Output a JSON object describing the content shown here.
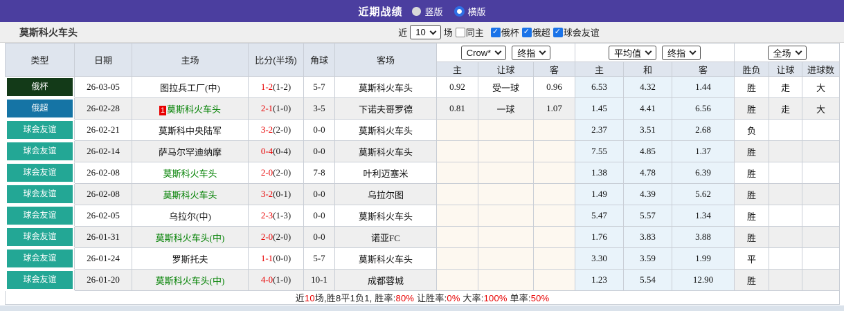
{
  "topbar": {
    "title": "近期战绩",
    "radio_vertical": "竖版",
    "radio_horizontal": "横版"
  },
  "toolbar": {
    "team": "莫斯科火车头",
    "near": "近",
    "count": "10",
    "games": "场",
    "same_home": "同主",
    "checks": [
      "俄杯",
      "俄超",
      "球会友谊"
    ]
  },
  "selects": {
    "bookmaker": "Crow*",
    "final_a": "终指",
    "avg": "平均值",
    "final_b": "终指",
    "scope": "全场"
  },
  "columns": {
    "type": "类型",
    "date": "日期",
    "home": "主场",
    "score": "比分(半场)",
    "corner": "角球",
    "away": "客场",
    "asia_home": "主",
    "asia_line": "让球",
    "asia_away": "客",
    "euro_home": "主",
    "euro_draw": "和",
    "euro_away": "客",
    "result": "胜负",
    "cover": "让球",
    "goals": "进球数"
  },
  "icons": {
    "checkbox-checked": "✓",
    "dropdown-chevron": "v"
  },
  "colors": {
    "topbar": "#4b3e9f",
    "cup": "#133a18",
    "super": "#1574a5",
    "friendly": "#23a795",
    "euro_bg": "#e9f3fa",
    "nodata_bg": "#fdf8f0",
    "win": "#e80000",
    "draw": "#008000",
    "lose": "#2626d9",
    "team_green": "#008000"
  },
  "table": {
    "rows": [
      {
        "cls": "cup",
        "type": "俄杯",
        "date": "26-03-05",
        "badge": "",
        "home": "图拉兵工厂(中)",
        "hg": false,
        "score": "1-2",
        "half": "(1-2)",
        "corner": "5-7",
        "away": "莫斯科火车头",
        "ag": true,
        "ah": "0.92",
        "line": "受一球",
        "aa": "0.96",
        "eh": "6.53",
        "ed": "4.32",
        "ea": "1.44",
        "res": "胜",
        "resc": "r",
        "cov": "走",
        "covc": "g",
        "goal": "大",
        "goalc": "r"
      },
      {
        "cls": "super",
        "type": "俄超",
        "date": "26-02-28",
        "badge": "1",
        "home": "莫斯科火车头",
        "hg": true,
        "score": "2-1",
        "half": "(1-0)",
        "corner": "3-5",
        "away": "下诺夫哥罗德",
        "ag": false,
        "ah": "0.81",
        "line": "一球",
        "aa": "1.07",
        "eh": "1.45",
        "ed": "4.41",
        "ea": "6.56",
        "res": "胜",
        "resc": "r",
        "cov": "走",
        "covc": "g",
        "goal": "大",
        "goalc": "r"
      },
      {
        "cls": "friendly",
        "type": "球会友谊",
        "date": "26-02-21",
        "badge": "",
        "home": "莫斯科中央陆军",
        "hg": false,
        "score": "3-2",
        "half": "(2-0)",
        "corner": "0-0",
        "away": "莫斯科火车头",
        "ag": true,
        "ah": "",
        "line": "",
        "aa": "",
        "eh": "2.37",
        "ed": "3.51",
        "ea": "2.68",
        "res": "负",
        "resc": "b",
        "cov": "",
        "covc": "",
        "goal": "",
        "goalc": ""
      },
      {
        "cls": "friendly",
        "type": "球会友谊",
        "date": "26-02-14",
        "badge": "",
        "home": "萨马尔罕迪纳摩",
        "hg": false,
        "score": "0-4",
        "half": "(0-4)",
        "corner": "0-0",
        "away": "莫斯科火车头",
        "ag": true,
        "ah": "",
        "line": "",
        "aa": "",
        "eh": "7.55",
        "ed": "4.85",
        "ea": "1.37",
        "res": "胜",
        "resc": "r",
        "cov": "",
        "covc": "",
        "goal": "",
        "goalc": ""
      },
      {
        "cls": "friendly",
        "type": "球会友谊",
        "date": "26-02-08",
        "badge": "",
        "home": "莫斯科火车头",
        "hg": true,
        "score": "2-0",
        "half": "(2-0)",
        "corner": "7-8",
        "away": "叶利迈塞米",
        "ag": false,
        "ah": "",
        "line": "",
        "aa": "",
        "eh": "1.38",
        "ed": "4.78",
        "ea": "6.39",
        "res": "胜",
        "resc": "r",
        "cov": "",
        "covc": "",
        "goal": "",
        "goalc": ""
      },
      {
        "cls": "friendly",
        "type": "球会友谊",
        "date": "26-02-08",
        "badge": "",
        "home": "莫斯科火车头",
        "hg": true,
        "score": "3-2",
        "half": "(0-1)",
        "corner": "0-0",
        "away": "乌拉尔图",
        "ag": false,
        "ah": "",
        "line": "",
        "aa": "",
        "eh": "1.49",
        "ed": "4.39",
        "ea": "5.62",
        "res": "胜",
        "resc": "r",
        "cov": "",
        "covc": "",
        "goal": "",
        "goalc": ""
      },
      {
        "cls": "friendly",
        "type": "球会友谊",
        "date": "26-02-05",
        "badge": "",
        "home": "乌拉尔(中)",
        "hg": false,
        "score": "2-3",
        "half": "(1-3)",
        "corner": "0-0",
        "away": "莫斯科火车头",
        "ag": true,
        "ah": "",
        "line": "",
        "aa": "",
        "eh": "5.47",
        "ed": "5.57",
        "ea": "1.34",
        "res": "胜",
        "resc": "r",
        "cov": "",
        "covc": "",
        "goal": "",
        "goalc": ""
      },
      {
        "cls": "friendly",
        "type": "球会友谊",
        "date": "26-01-31",
        "badge": "",
        "home": "莫斯科火车头(中)",
        "hg": true,
        "score": "2-0",
        "half": "(2-0)",
        "corner": "0-0",
        "away": "诺亚FC",
        "ag": false,
        "ah": "",
        "line": "",
        "aa": "",
        "eh": "1.76",
        "ed": "3.83",
        "ea": "3.88",
        "res": "胜",
        "resc": "r",
        "cov": "",
        "covc": "",
        "goal": "",
        "goalc": ""
      },
      {
        "cls": "friendly",
        "type": "球会友谊",
        "date": "26-01-24",
        "badge": "",
        "home": "罗斯托夫",
        "hg": false,
        "score": "1-1",
        "half": "(0-0)",
        "corner": "5-7",
        "away": "莫斯科火车头",
        "ag": true,
        "ah": "",
        "line": "",
        "aa": "",
        "eh": "3.30",
        "ed": "3.59",
        "ea": "1.99",
        "res": "平",
        "resc": "g",
        "cov": "",
        "covc": "",
        "goal": "",
        "goalc": ""
      },
      {
        "cls": "friendly",
        "type": "球会友谊",
        "date": "26-01-20",
        "badge": "",
        "home": "莫斯科火车头(中)",
        "hg": true,
        "score": "4-0",
        "half": "(1-0)",
        "corner": "10-1",
        "away": "成都蓉城",
        "ag": false,
        "ah": "",
        "line": "",
        "aa": "",
        "eh": "1.23",
        "ed": "5.54",
        "ea": "12.90",
        "res": "胜",
        "resc": "r",
        "cov": "",
        "covc": "",
        "goal": "",
        "goalc": ""
      }
    ]
  },
  "footer": {
    "parts": [
      {
        "t": "近"
      },
      {
        "t": "10"
      },
      {
        "t": "场,胜8平1负1, 胜率:"
      },
      {
        "t": "80%"
      },
      {
        "t": " 让胜率:"
      },
      {
        "t": "0%"
      },
      {
        "t": " 大率:"
      },
      {
        "t": "100%"
      },
      {
        "t": " 单率:"
      },
      {
        "t": "50%"
      }
    ]
  }
}
